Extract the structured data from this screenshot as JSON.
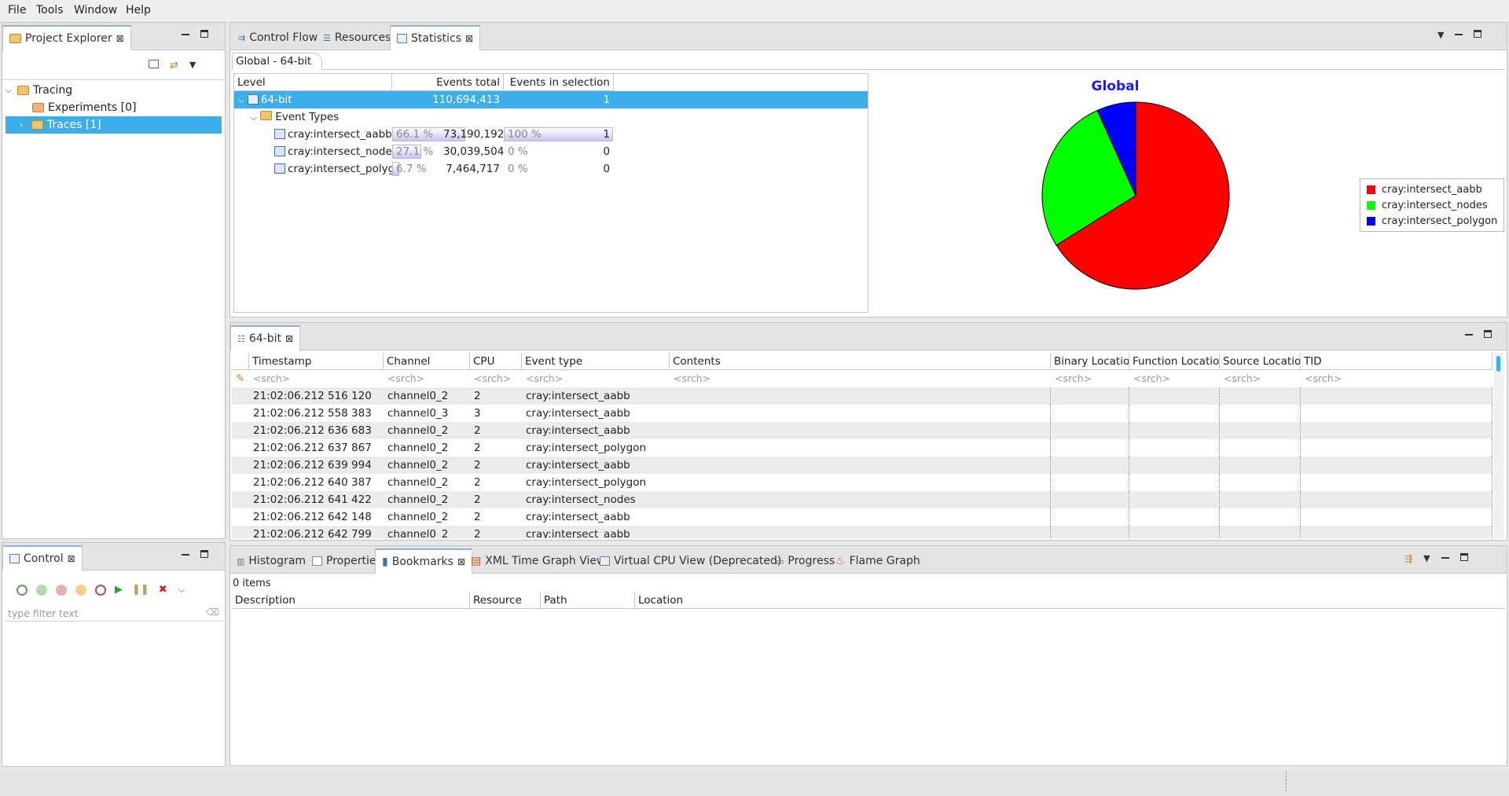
{
  "menu": [
    "File",
    "Tools",
    "Window",
    "Help"
  ],
  "project_explorer": {
    "tab_label": "Project Explorer",
    "tree": [
      {
        "label": "Tracing",
        "expanded": true
      },
      {
        "label": "Experiments [0]"
      },
      {
        "label": "Traces [1]",
        "selected": true
      }
    ]
  },
  "top_tabs": [
    "Control Flow",
    "Resources",
    "Statistics"
  ],
  "statistics": {
    "subtab": "Global - 64-bit",
    "headers": [
      "Level",
      "Events total",
      "Events in selection"
    ],
    "root": {
      "label": "64-bit",
      "total": "110,694,413",
      "selection": "1"
    },
    "group": "Event Types",
    "rows": [
      {
        "label": "cray:intersect_aabb",
        "pct_total": "66.1 %",
        "total": "73,190,192",
        "pct_sel": "100 %",
        "selection": "1",
        "total_fraction": 0.661,
        "sel_fraction": 1.0
      },
      {
        "label": "cray:intersect_nodes",
        "pct_total": "27.1 %",
        "total": "30,039,504",
        "pct_sel": "0 %",
        "selection": "0",
        "total_fraction": 0.271,
        "sel_fraction": 0.0
      },
      {
        "label": "cray:intersect_polygo",
        "pct_total": "6.7 %",
        "total": "7,464,717",
        "pct_sel": "0 %",
        "selection": "0",
        "total_fraction": 0.067,
        "sel_fraction": 0.0
      }
    ]
  },
  "chart_data": {
    "type": "pie",
    "title": "Global",
    "labels": [
      "cray:intersect_aabb",
      "cray:intersect_nodes",
      "cray:intersect_polygon"
    ],
    "values": [
      73190192,
      30039504,
      7464717
    ],
    "colors": [
      "#ff0000",
      "#00ff00",
      "#0000ff"
    ],
    "legend_position": "right"
  },
  "events": {
    "tab_label": "64-bit",
    "headers": [
      "Timestamp",
      "Channel",
      "CPU",
      "Event type",
      "Contents",
      "Binary Location",
      "Function Location",
      "Source Location",
      "TID"
    ],
    "search_placeholder": "<srch>",
    "rows": [
      [
        "21:02:06.212 516 120",
        "channel0_2",
        "2",
        "cray:intersect_aabb"
      ],
      [
        "21:02:06.212 558 383",
        "channel0_3",
        "3",
        "cray:intersect_aabb"
      ],
      [
        "21:02:06.212 636 683",
        "channel0_2",
        "2",
        "cray:intersect_aabb"
      ],
      [
        "21:02:06.212 637 867",
        "channel0_2",
        "2",
        "cray:intersect_polygon"
      ],
      [
        "21:02:06.212 639 994",
        "channel0_2",
        "2",
        "cray:intersect_aabb"
      ],
      [
        "21:02:06.212 640 387",
        "channel0_2",
        "2",
        "cray:intersect_polygon"
      ],
      [
        "21:02:06.212 641 422",
        "channel0_2",
        "2",
        "cray:intersect_nodes"
      ],
      [
        "21:02:06.212 642 148",
        "channel0_2",
        "2",
        "cray:intersect_aabb"
      ],
      [
        "21:02:06.212 642 799",
        "channel0_2",
        "2",
        "cray:intersect_aabb"
      ]
    ]
  },
  "control": {
    "tab_label": "Control",
    "filter_placeholder": "type filter text"
  },
  "bottom_tabs": [
    "Histogram",
    "Properties",
    "Bookmarks",
    "XML Time Graph View",
    "Virtual CPU View (Deprecated)",
    "Progress",
    "Flame Graph"
  ],
  "bookmarks": {
    "count_label": "0 items",
    "headers": [
      "Description",
      "Resource",
      "Path",
      "Location"
    ]
  }
}
